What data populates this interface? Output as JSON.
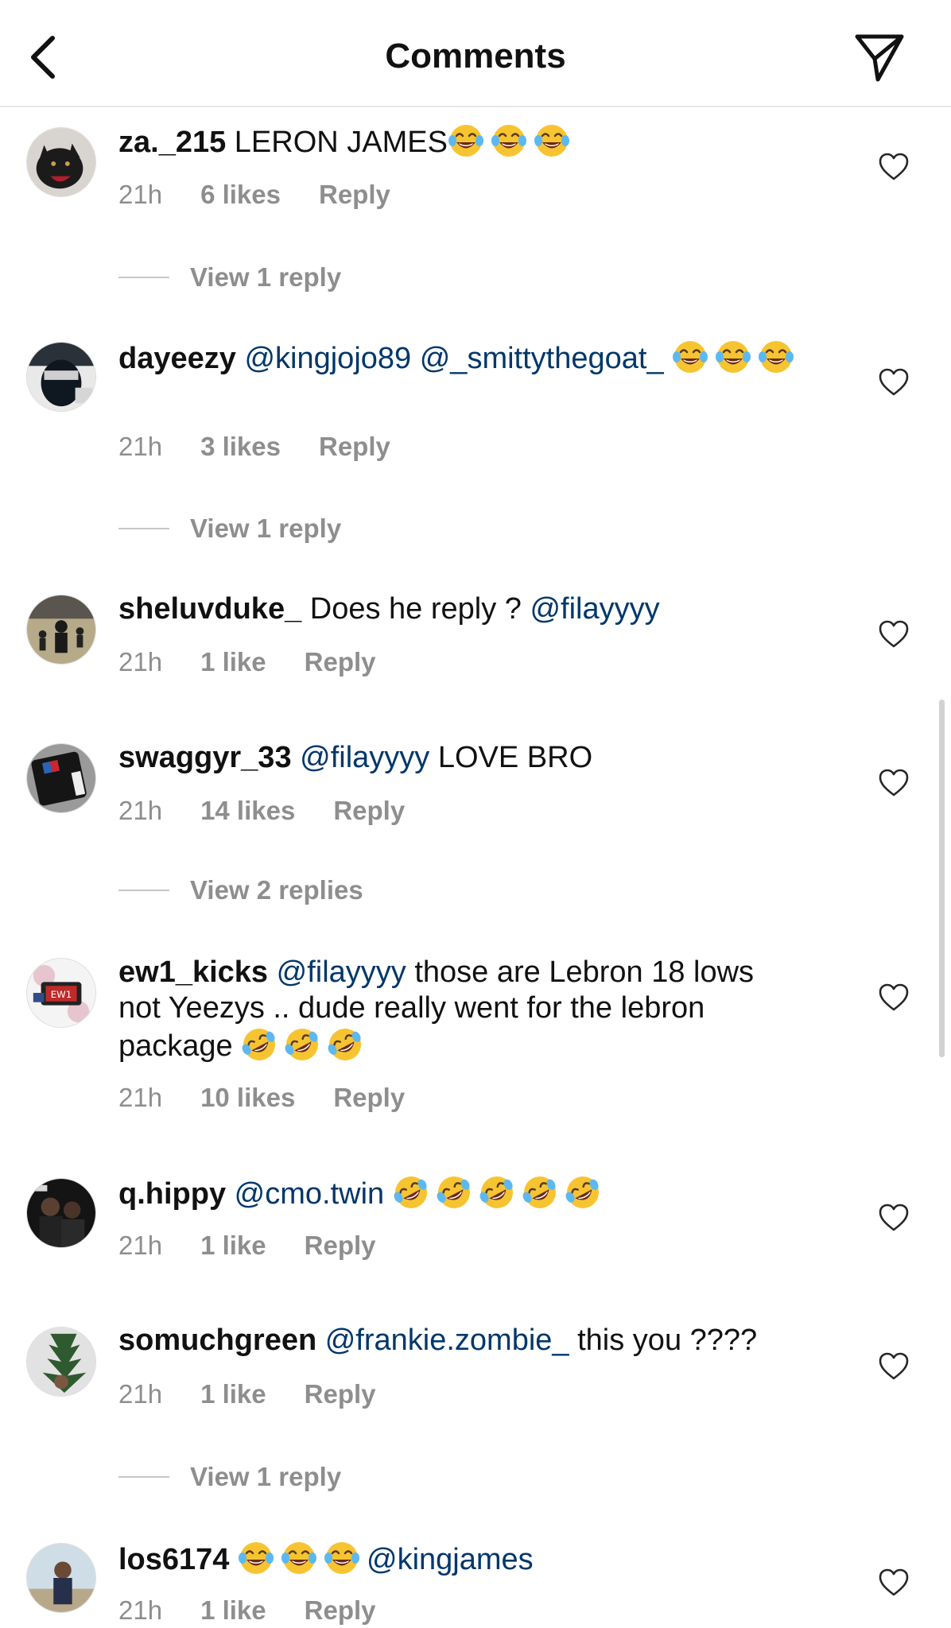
{
  "header": {
    "title": "Comments"
  },
  "comments": [
    {
      "username": "za._215",
      "parts": [
        {
          "t": "text",
          "v": " LERON JAMES"
        },
        {
          "t": "emoji",
          "v": "joy"
        },
        {
          "t": "emoji",
          "v": "joy"
        },
        {
          "t": "emoji",
          "v": "joy"
        }
      ],
      "time": "21h",
      "likes": "6 likes",
      "reply": "Reply",
      "view_replies": "View 1 reply"
    },
    {
      "username": "dayeezy",
      "parts": [
        {
          "t": "text",
          "v": " "
        },
        {
          "t": "mention",
          "v": "@kingjojo89"
        },
        {
          "t": "text",
          "v": " "
        },
        {
          "t": "mention",
          "v": "@_smittythegoat_"
        },
        {
          "t": "text",
          "v": " "
        },
        {
          "t": "emoji",
          "v": "joy"
        },
        {
          "t": "emoji",
          "v": "joy"
        },
        {
          "t": "emoji",
          "v": "joy"
        }
      ],
      "time": "21h",
      "likes": "3 likes",
      "reply": "Reply",
      "view_replies": "View 1 reply"
    },
    {
      "username": "sheluvduke_",
      "parts": [
        {
          "t": "text",
          "v": " Does he reply ? "
        },
        {
          "t": "mention",
          "v": "@filayyyy"
        }
      ],
      "time": "21h",
      "likes": "1 like",
      "reply": "Reply",
      "view_replies": ""
    },
    {
      "username": "swaggyr_33",
      "parts": [
        {
          "t": "text",
          "v": " "
        },
        {
          "t": "mention",
          "v": "@filayyyy"
        },
        {
          "t": "text",
          "v": " LOVE BRO"
        }
      ],
      "time": "21h",
      "likes": "14 likes",
      "reply": "Reply",
      "view_replies": "View 2 replies"
    },
    {
      "username": "ew1_kicks",
      "parts": [
        {
          "t": "text",
          "v": " "
        },
        {
          "t": "mention",
          "v": "@filayyyy"
        },
        {
          "t": "text",
          "v": " those are Lebron 18 lows not Yeezys .. dude really went for the lebron package "
        },
        {
          "t": "emoji",
          "v": "rofl"
        },
        {
          "t": "emoji",
          "v": "rofl"
        },
        {
          "t": "emoji",
          "v": "rofl"
        }
      ],
      "time": "21h",
      "likes": "10 likes",
      "reply": "Reply",
      "view_replies": ""
    },
    {
      "username": "q.hippy",
      "parts": [
        {
          "t": "text",
          "v": " "
        },
        {
          "t": "mention",
          "v": "@cmo.twin"
        },
        {
          "t": "text",
          "v": " "
        },
        {
          "t": "emoji",
          "v": "rofl"
        },
        {
          "t": "emoji",
          "v": "rofl"
        },
        {
          "t": "emoji",
          "v": "rofl"
        },
        {
          "t": "emoji",
          "v": "rofl"
        },
        {
          "t": "emoji",
          "v": "rofl"
        }
      ],
      "time": "21h",
      "likes": "1 like",
      "reply": "Reply",
      "view_replies": ""
    },
    {
      "username": "somuchgreen",
      "parts": [
        {
          "t": "text",
          "v": " "
        },
        {
          "t": "mention",
          "v": "@frankie.zombie_"
        },
        {
          "t": "text",
          "v": "  this you ????"
        }
      ],
      "time": "21h",
      "likes": "1 like",
      "reply": "Reply",
      "view_replies": "View 1 reply"
    },
    {
      "username": "los6174",
      "parts": [
        {
          "t": "text",
          "v": " "
        },
        {
          "t": "emoji",
          "v": "joy"
        },
        {
          "t": "emoji",
          "v": "joy"
        },
        {
          "t": "emoji",
          "v": "joy"
        },
        {
          "t": "mention",
          "v": "@kingjames"
        }
      ],
      "time": "21h",
      "likes": "1 like",
      "reply": "Reply",
      "view_replies": ""
    }
  ],
  "icons": {
    "back": "chevron-left-icon",
    "send": "send-icon",
    "like": "heart-outline-icon",
    "emoji_joy": "face-with-tears-of-joy",
    "emoji_rofl": "rolling-on-floor-laughing"
  },
  "colors": {
    "mention": "#00376b",
    "meta": "#8e8e8e",
    "emoji_face": "#f7c431",
    "emoji_tears": "#5db8f0"
  }
}
